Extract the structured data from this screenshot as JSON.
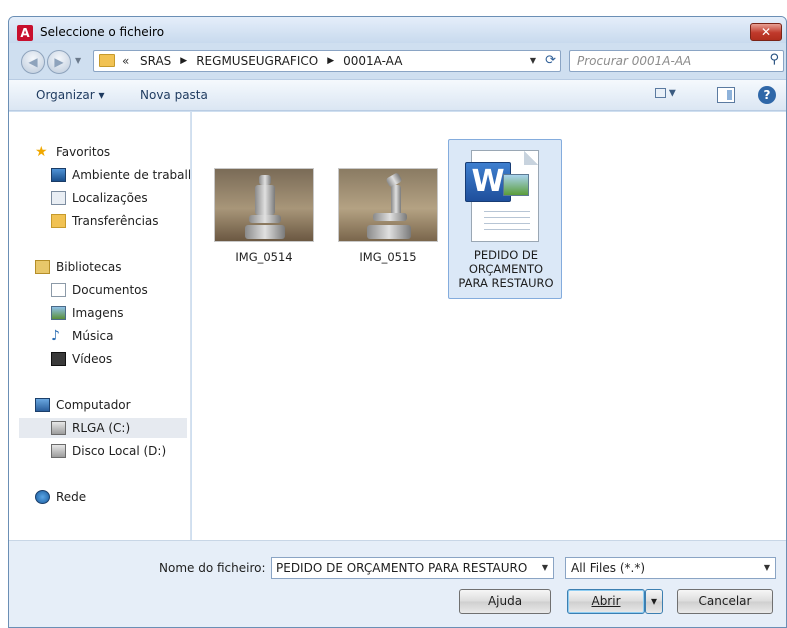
{
  "window": {
    "title": "Seleccione o ficheiro",
    "app_icon": "A"
  },
  "navigation": {
    "breadcrumb": [
      "SRAS",
      "REGMUSEUGRAFICO",
      "0001A-AA"
    ],
    "search_placeholder": "Procurar 0001A-AA"
  },
  "toolbar": {
    "organize_label": "Organizar ▾",
    "new_folder_label": "Nova pasta"
  },
  "sidebar": {
    "items": [
      {
        "label": "Favoritos",
        "icon": "star-icon"
      },
      {
        "label": "Ambiente de trabalho",
        "icon": "desktop-icon"
      },
      {
        "label": "Localizações",
        "icon": "places-icon"
      },
      {
        "label": "Transferências",
        "icon": "downloads-icon"
      },
      {
        "label": "Bibliotecas",
        "icon": "library-icon"
      },
      {
        "label": "Documentos",
        "icon": "document-icon"
      },
      {
        "label": "Imagens",
        "icon": "image-icon"
      },
      {
        "label": "Música",
        "icon": "music-icon"
      },
      {
        "label": "Vídeos",
        "icon": "video-icon"
      },
      {
        "label": "Computador",
        "icon": "computer-icon"
      },
      {
        "label": "RLGA (C:)",
        "icon": "drive-icon"
      },
      {
        "label": "Disco Local (D:)",
        "icon": "drive-icon"
      },
      {
        "label": "Rede",
        "icon": "network-icon"
      }
    ]
  },
  "files": [
    {
      "name": "IMG_0514"
    },
    {
      "name": "IMG_0515"
    },
    {
      "name": "PEDIDO DE ORÇAMENTO PARA RESTAURO"
    }
  ],
  "bottom": {
    "filename_label": "Nome do ficheiro:",
    "filename_value": "PEDIDO DE ORÇAMENTO PARA RESTAURO",
    "filter_value": "All Files (*.*)",
    "help_label": "Ajuda",
    "open_label": "Abrir",
    "cancel_label": "Cancelar"
  }
}
